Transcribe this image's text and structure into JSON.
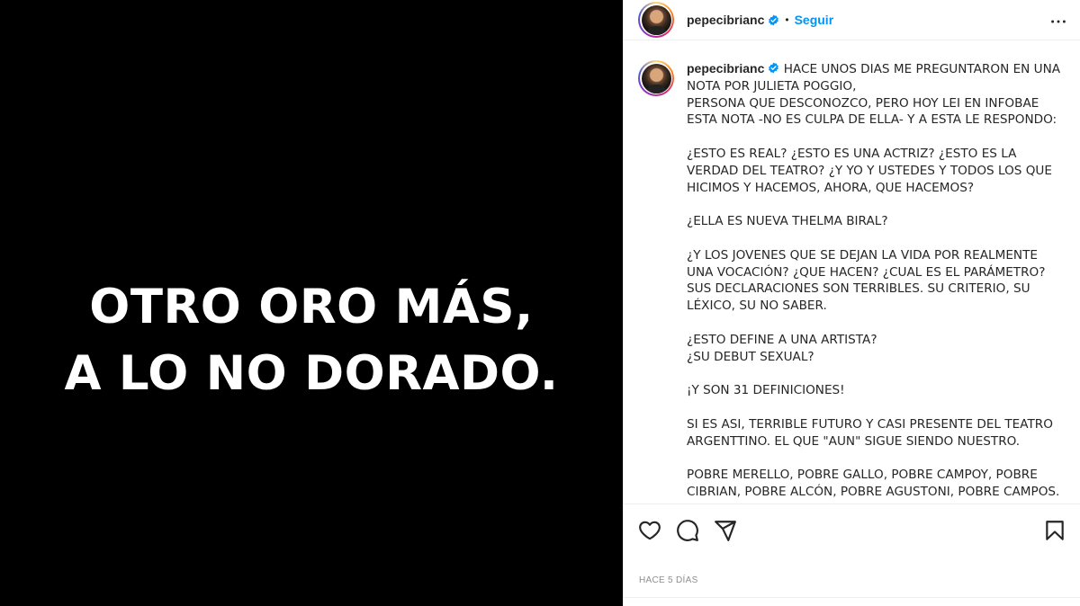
{
  "media": {
    "line1": "OTRO ORO MÁS,",
    "line2": "A LO NO DORADO."
  },
  "header": {
    "username": "pepecibrianc",
    "separator": "•",
    "follow_label": "Seguir"
  },
  "caption": {
    "username": "pepecibrianc",
    "text": "HACE UNOS DIAS ME PREGUNTARON EN UNA NOTA POR JULIETA POGGIO,\nPERSONA QUE DESCONOZCO, PERO HOY LEI EN INFOBAE ESTA NOTA -NO ES CULPA DE ELLA- Y A ESTA LE RESPONDO:\n\n¿ESTO ES REAL? ¿ESTO ES UNA ACTRIZ? ¿ESTO ES LA VERDAD DEL TEATRO? ¿Y YO Y USTEDES Y TODOS LOS QUE HICIMOS Y HACEMOS, AHORA, QUE HACEMOS?\n\n¿ELLA ES NUEVA THELMA BIRAL?\n\n¿Y LOS JOVENES QUE SE DEJAN LA VIDA POR REALMENTE UNA VOCACIÓN? ¿QUE HACEN? ¿CUAL ES EL PARÁMETRO? SUS DECLARACIONES SON TERRIBLES. SU CRITERIO, SU LÉXICO, SU NO SABER.\n\n¿ESTO DEFINE A UNA ARTISTA?\n¿SU DEBUT SEXUAL?\n\n¡Y SON 31 DEFINICIONES!\n\nSI ES ASI, TERRIBLE FUTURO Y CASI PRESENTE DEL TEATRO ARGENTTINO. EL QUE \"AUN\" SIGUE SIENDO NUESTRO.\n\nPOBRE MERELLO, POBRE GALLO, POBRE CAMPOY, POBRE CIBRIAN, POBRE ALCÓN, POBRE AGUSTONI, POBRE CAMPOS."
  },
  "icons": {
    "like": "heart-icon",
    "comment": "comment-icon",
    "share": "send-icon",
    "save": "bookmark-icon",
    "more": "more-horizontal-icon",
    "verified": "verified-badge-icon"
  },
  "colors": {
    "follow_blue": "#0095f6",
    "verified_blue": "#0095f6",
    "timestamp_gray": "#8e8e8e"
  },
  "timestamp": "HACE 5 DÍAS"
}
